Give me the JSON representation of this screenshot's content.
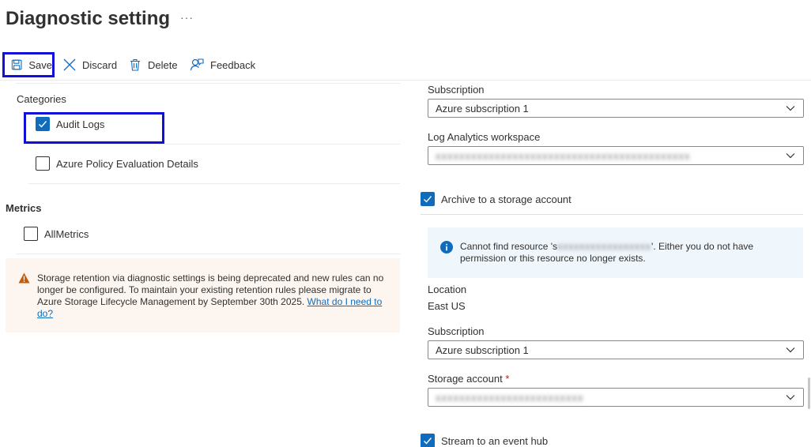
{
  "header": {
    "title": "Diagnostic setting",
    "more": "···"
  },
  "toolbar": {
    "save_label": "Save",
    "discard_label": "Discard",
    "delete_label": "Delete",
    "feedback_label": "Feedback"
  },
  "logs": {
    "categories_label": "Categories",
    "items": [
      {
        "label": "Audit Logs",
        "checked": true
      },
      {
        "label": "Azure Policy Evaluation Details",
        "checked": false
      }
    ]
  },
  "metrics": {
    "label": "Metrics",
    "items": [
      {
        "label": "AllMetrics",
        "checked": false
      }
    ]
  },
  "warning": {
    "text": "Storage retention via diagnostic settings is being deprecated and new rules can no longer be configured. To maintain your existing retention rules please migrate to Azure Storage Lifecycle Management by September 30th 2025. ",
    "link": "What do I need to do?"
  },
  "log_analytics": {
    "subscription_label": "Subscription",
    "subscription_value": "Azure subscription 1",
    "workspace_label": "Log Analytics workspace",
    "workspace_value": "xxxxxxxxxxxxxxxxxxxxxxxxxxxxxxxxxxxxxxxxxxx"
  },
  "storage": {
    "archive_label": "Archive to a storage account",
    "archive_checked": true,
    "info_prefix": "Cannot find resource 's",
    "info_blurred": "xxxxxxxxxxxxxxxxx",
    "info_suffix": "'. Either you do not have permission or this resource no longer exists.",
    "location_label": "Location",
    "location_value": "East US",
    "subscription_label": "Subscription",
    "subscription_value": "Azure subscription 1",
    "account_label": "Storage account",
    "account_required": "*",
    "account_value": "xxxxxxxxxxxxxxxxxxxxxxxxx"
  },
  "event_hub": {
    "label": "Stream to an event hub",
    "checked": true
  },
  "colors": {
    "accent": "#0f6cbd",
    "highlight": "#1010d8",
    "warning_bg": "#fdf6f0",
    "info_bg": "#eff6fc"
  }
}
